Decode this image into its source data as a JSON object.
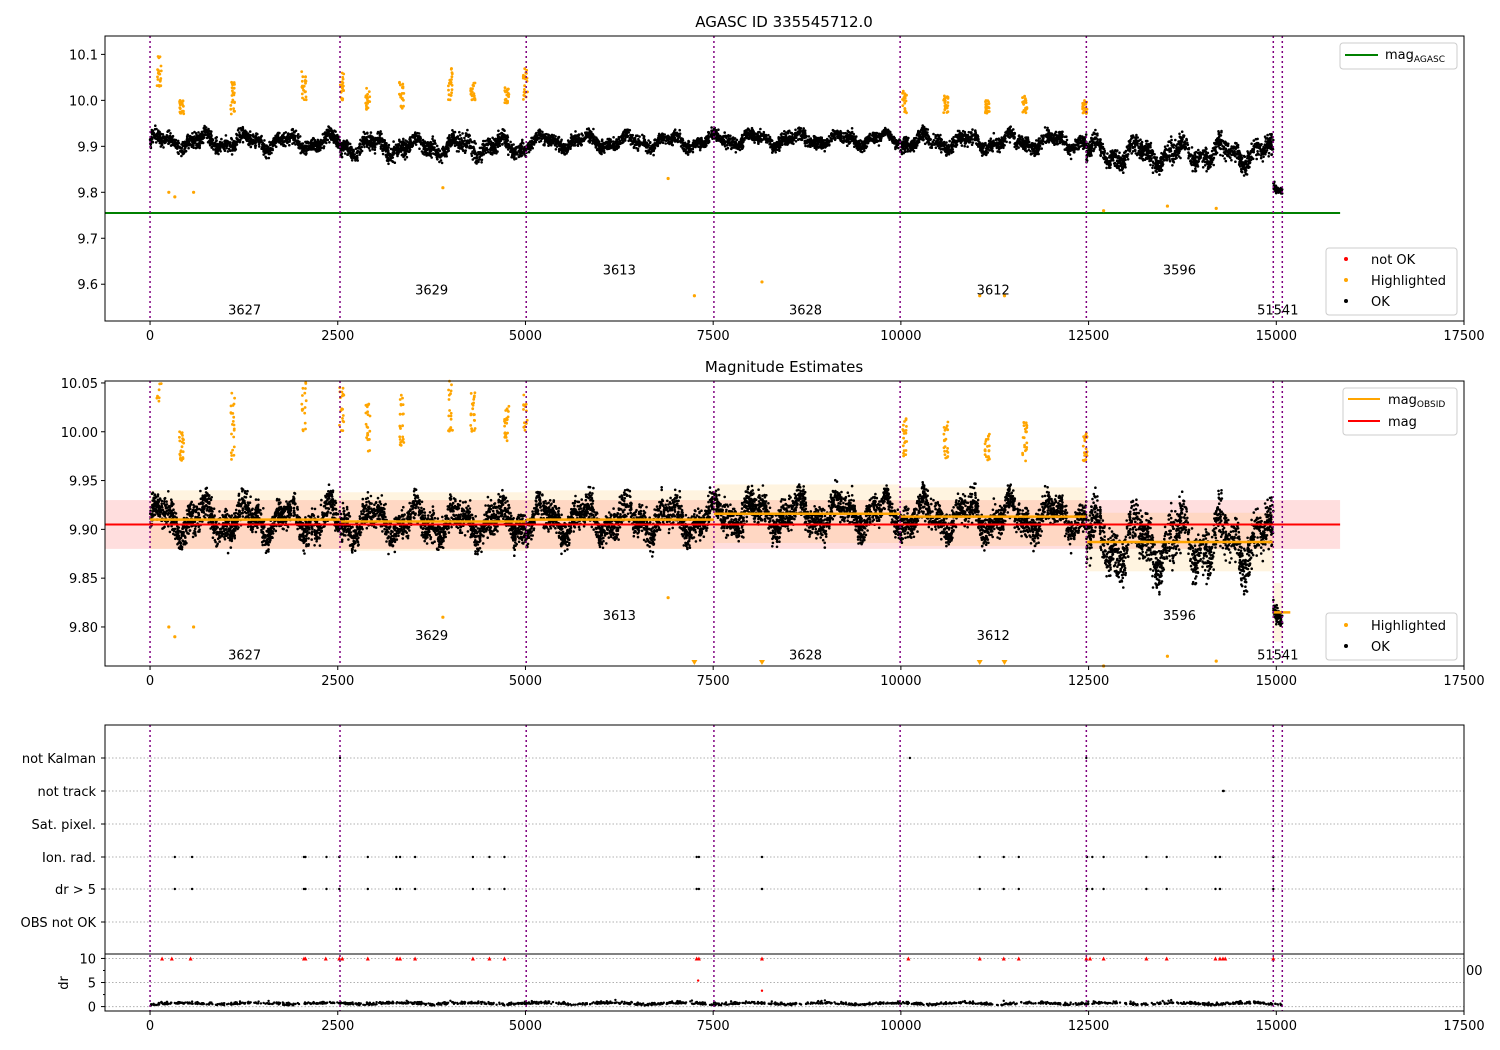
{
  "chart_data": [
    {
      "type": "scatter",
      "title": "AGASC ID 335545712.0",
      "xlim": [
        -600,
        17500
      ],
      "ylim": [
        9.52,
        10.14
      ],
      "xticks": [
        0,
        2500,
        5000,
        7500,
        10000,
        12500,
        15000,
        17500
      ],
      "yticks": [
        9.6,
        9.7,
        9.8,
        9.9,
        10.0,
        10.1
      ],
      "obs_boundaries": [
        0,
        2530,
        5010,
        7510,
        9990,
        12470,
        14960,
        15080
      ],
      "obsid_labels": [
        {
          "text": "3627",
          "x": 1260,
          "y": 9.545
        },
        {
          "text": "3629",
          "x": 3750,
          "y": 9.588
        },
        {
          "text": "3613",
          "x": 6250,
          "y": 9.632
        },
        {
          "text": "3628",
          "x": 8730,
          "y": 9.545
        },
        {
          "text": "3612",
          "x": 11230,
          "y": 9.588
        },
        {
          "text": "3596",
          "x": 13710,
          "y": 9.632
        },
        {
          "text": "51541",
          "x": 15020,
          "y": 9.545
        }
      ],
      "lines": [
        {
          "name": "mag_AGASC",
          "x": [
            -600,
            15850
          ],
          "y": [
            9.755,
            9.755
          ],
          "color": "#008000"
        }
      ],
      "ok_segments": [
        {
          "x": [
            0,
            2530
          ],
          "center": 9.91,
          "spread": 0.035
        },
        {
          "x": [
            2530,
            5010
          ],
          "center": 9.9,
          "spread": 0.04
        },
        {
          "x": [
            5010,
            7510
          ],
          "center": 9.91,
          "spread": 0.03
        },
        {
          "x": [
            7510,
            9990
          ],
          "center": 9.915,
          "spread": 0.03
        },
        {
          "x": [
            9990,
            12470
          ],
          "center": 9.91,
          "spread": 0.035
        },
        {
          "x": [
            12470,
            14960
          ],
          "center": 9.885,
          "spread": 0.05
        },
        {
          "x": [
            14960,
            15080
          ],
          "center": 9.81,
          "spread": 0.02
        }
      ],
      "highlighted_clusters": [
        {
          "x": 120,
          "y": [
            10.03,
            10.1
          ]
        },
        {
          "x": 420,
          "y": [
            9.97,
            10.0
          ]
        },
        {
          "x": 1100,
          "y": [
            9.97,
            10.04
          ]
        },
        {
          "x": 2050,
          "y": [
            10.0,
            10.07
          ]
        },
        {
          "x": 2550,
          "y": [
            10.0,
            10.07
          ]
        },
        {
          "x": 2900,
          "y": [
            9.98,
            10.03
          ]
        },
        {
          "x": 3350,
          "y": [
            9.98,
            10.04
          ]
        },
        {
          "x": 4000,
          "y": [
            10.0,
            10.07
          ]
        },
        {
          "x": 4300,
          "y": [
            10.0,
            10.04
          ]
        },
        {
          "x": 4750,
          "y": [
            9.99,
            10.03
          ]
        },
        {
          "x": 5000,
          "y": [
            10.0,
            10.07
          ]
        },
        {
          "x": 10050,
          "y": [
            9.97,
            10.02
          ]
        },
        {
          "x": 10600,
          "y": [
            9.97,
            10.01
          ]
        },
        {
          "x": 11150,
          "y": [
            9.97,
            10.0
          ]
        },
        {
          "x": 11650,
          "y": [
            9.97,
            10.01
          ]
        },
        {
          "x": 12450,
          "y": [
            9.97,
            10.0
          ]
        }
      ],
      "highlighted_points": [
        {
          "x": 250,
          "y": 9.8
        },
        {
          "x": 330,
          "y": 9.79
        },
        {
          "x": 580,
          "y": 9.8
        },
        {
          "x": 3900,
          "y": 9.81
        },
        {
          "x": 7250,
          "y": 9.575
        },
        {
          "x": 8150,
          "y": 9.605
        },
        {
          "x": 11050,
          "y": 9.575
        },
        {
          "x": 11380,
          "y": 9.575
        },
        {
          "x": 12700,
          "y": 9.76
        },
        {
          "x": 13550,
          "y": 9.77
        },
        {
          "x": 14200,
          "y": 9.765
        },
        {
          "x": 6900,
          "y": 9.83
        }
      ],
      "legend_top": {
        "entries": [
          {
            "label": "mag_AGASC",
            "main": "mag",
            "sub": "AGASC",
            "color": "#008000"
          }
        ],
        "loc": "upper right"
      },
      "legend_bottom": {
        "entries": [
          {
            "label": "not OK",
            "color": "#ff0000"
          },
          {
            "label": "Highlighted",
            "color": "#ffa500"
          },
          {
            "label": "OK",
            "color": "#000000"
          }
        ],
        "loc": "lower right"
      }
    },
    {
      "type": "scatter",
      "title": "Magnitude Estimates",
      "xlim": [
        -600,
        17500
      ],
      "ylim": [
        9.76,
        10.052
      ],
      "xticks": [
        0,
        2500,
        5000,
        7500,
        10000,
        12500,
        15000,
        17500
      ],
      "yticks": [
        9.8,
        9.85,
        9.9,
        9.95,
        10.0,
        10.05
      ],
      "mag": {
        "value": 9.905,
        "band": [
          9.88,
          9.93
        ],
        "x": [
          -600,
          15850
        ],
        "color": "#ff0000"
      },
      "mag_obsid": [
        {
          "x": [
            0,
            2530
          ],
          "y": 9.91
        },
        {
          "x": [
            2530,
            5010
          ],
          "y": 9.908
        },
        {
          "x": [
            5010,
            7510
          ],
          "y": 9.91
        },
        {
          "x": [
            7510,
            9990
          ],
          "y": 9.916
        },
        {
          "x": [
            9990,
            12470
          ],
          "y": 9.913
        },
        {
          "x": [
            12470,
            14960
          ],
          "y": 9.887
        },
        {
          "x": [
            14960,
            15080
          ],
          "y": 9.815
        }
      ],
      "obsid_labels": [
        {
          "text": "3627",
          "x": 1260,
          "y": 9.772
        },
        {
          "text": "3629",
          "x": 3750,
          "y": 9.792
        },
        {
          "text": "3613",
          "x": 6250,
          "y": 9.812
        },
        {
          "text": "3628",
          "x": 8730,
          "y": 9.772
        },
        {
          "text": "3612",
          "x": 11230,
          "y": 9.792
        },
        {
          "text": "3596",
          "x": 13710,
          "y": 9.812
        },
        {
          "text": "51541",
          "x": 15020,
          "y": 9.772
        }
      ],
      "legend_top": {
        "entries": [
          {
            "label": "mag_OBSID",
            "main": "mag",
            "sub": "OBSID",
            "color": "#ffa500"
          },
          {
            "label": "mag",
            "main": "mag",
            "sub": "",
            "color": "#ff0000"
          }
        ],
        "loc": "upper right"
      },
      "legend_bottom": {
        "entries": [
          {
            "label": "Highlighted",
            "color": "#ffa500"
          },
          {
            "label": "OK",
            "color": "#000000"
          }
        ],
        "loc": "lower right"
      }
    },
    {
      "type": "scatter",
      "xlim": [
        -600,
        17500
      ],
      "xticks": [
        0,
        2500,
        5000,
        7500,
        10000,
        12500,
        15000,
        17500
      ],
      "flag_rows": [
        "not Kalman",
        "not track",
        "Sat. pixel.",
        "Ion. rad.",
        "dr > 5",
        "OBS not OK"
      ],
      "flag_points": {
        "not Kalman": [
          2530,
          10120,
          12470
        ],
        "not track": [
          14290,
          14300
        ],
        "Sat. pixel.": [],
        "Ion. rad.": [
          330,
          560,
          2050,
          2070,
          2350,
          2520,
          2900,
          3280,
          3330,
          3530,
          4300,
          4520,
          4720,
          7280,
          7310,
          8150,
          11050,
          11370,
          11570,
          12480,
          12550,
          12700,
          13270,
          13540,
          14190,
          14250,
          14960
        ],
        "dr > 5": [
          330,
          560,
          2050,
          2070,
          2350,
          2520,
          2900,
          3280,
          3330,
          3530,
          4300,
          4520,
          4720,
          7280,
          7310,
          8150,
          11050,
          11370,
          11570,
          12480,
          12550,
          12700,
          13270,
          13540,
          14190,
          14250,
          14960
        ],
        "OBS not OK": []
      },
      "dr_ylabel": "dr",
      "dr_ylim": [
        -0.5,
        10.3
      ],
      "dr_yticks": [
        0,
        5,
        10
      ],
      "dr_clipped_markers_x": [
        160,
        290,
        540,
        2050,
        2070,
        2340,
        2520,
        2560,
        2900,
        3290,
        3330,
        3530,
        4300,
        4520,
        4720,
        7280,
        7310,
        8150,
        10100,
        11050,
        11370,
        11570,
        12470,
        12520,
        12700,
        13270,
        13540,
        14190,
        14250,
        14290,
        14320,
        14960
      ],
      "dr_outliers": [
        {
          "x": 7300,
          "y": 5.4
        },
        {
          "x": 8150,
          "y": 3.3
        },
        {
          "x": 11370,
          "y": 1.2
        }
      ],
      "dr_stray_tick_label": "00",
      "dr_baseline": {
        "range": [
          0.2,
          1.2
        ]
      }
    }
  ]
}
